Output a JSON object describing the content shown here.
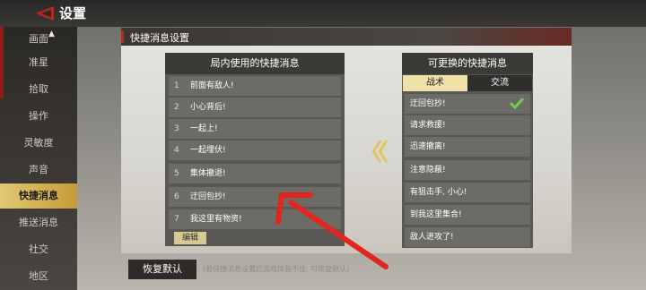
{
  "header": {
    "title": "设置"
  },
  "sidebar": {
    "items": [
      {
        "label": "画面"
      },
      {
        "label": "准星"
      },
      {
        "label": "拾取"
      },
      {
        "label": "操作"
      },
      {
        "label": "灵敏度"
      },
      {
        "label": "声音"
      },
      {
        "label": "快捷消息",
        "active": true
      },
      {
        "label": "推送消息"
      },
      {
        "label": "社交"
      },
      {
        "label": "地区"
      }
    ]
  },
  "panel": {
    "title": "快捷消息设置"
  },
  "in_game_list": {
    "title": "局内使用的快捷消息",
    "items": [
      {
        "num": "1",
        "text": "前面有敌人!"
      },
      {
        "num": "2",
        "text": "小心背后!"
      },
      {
        "num": "3",
        "text": "一起上!"
      },
      {
        "num": "4",
        "text": "一起埋伏!"
      },
      {
        "num": "5",
        "text": "集体撤退!"
      },
      {
        "num": "6",
        "text": "迂回包抄!"
      },
      {
        "num": "7",
        "text": "我这里有物资!"
      }
    ],
    "edit_label": "编辑"
  },
  "replaceable_list": {
    "title": "可更换的快捷消息",
    "tabs": [
      {
        "label": "战术",
        "selected": true
      },
      {
        "label": "交流"
      }
    ],
    "items": [
      {
        "text": "迂回包抄!",
        "checked": true
      },
      {
        "text": "请求救援!"
      },
      {
        "text": "迅速撤离!"
      },
      {
        "text": "注意隐蔽!"
      },
      {
        "text": "有狙击手, 小心!"
      },
      {
        "text": "到我这里集合!"
      },
      {
        "text": "敌人进攻了!"
      }
    ]
  },
  "footer": {
    "reset_label": "恢复默认",
    "hint": "(若快捷消息设置后游戏体验不佳, 可恢复默认)"
  },
  "colors": {
    "accent": "#e2c873",
    "brand_red": "#b52a22",
    "check": "#6ed04a",
    "annotation": "#e0261e"
  }
}
